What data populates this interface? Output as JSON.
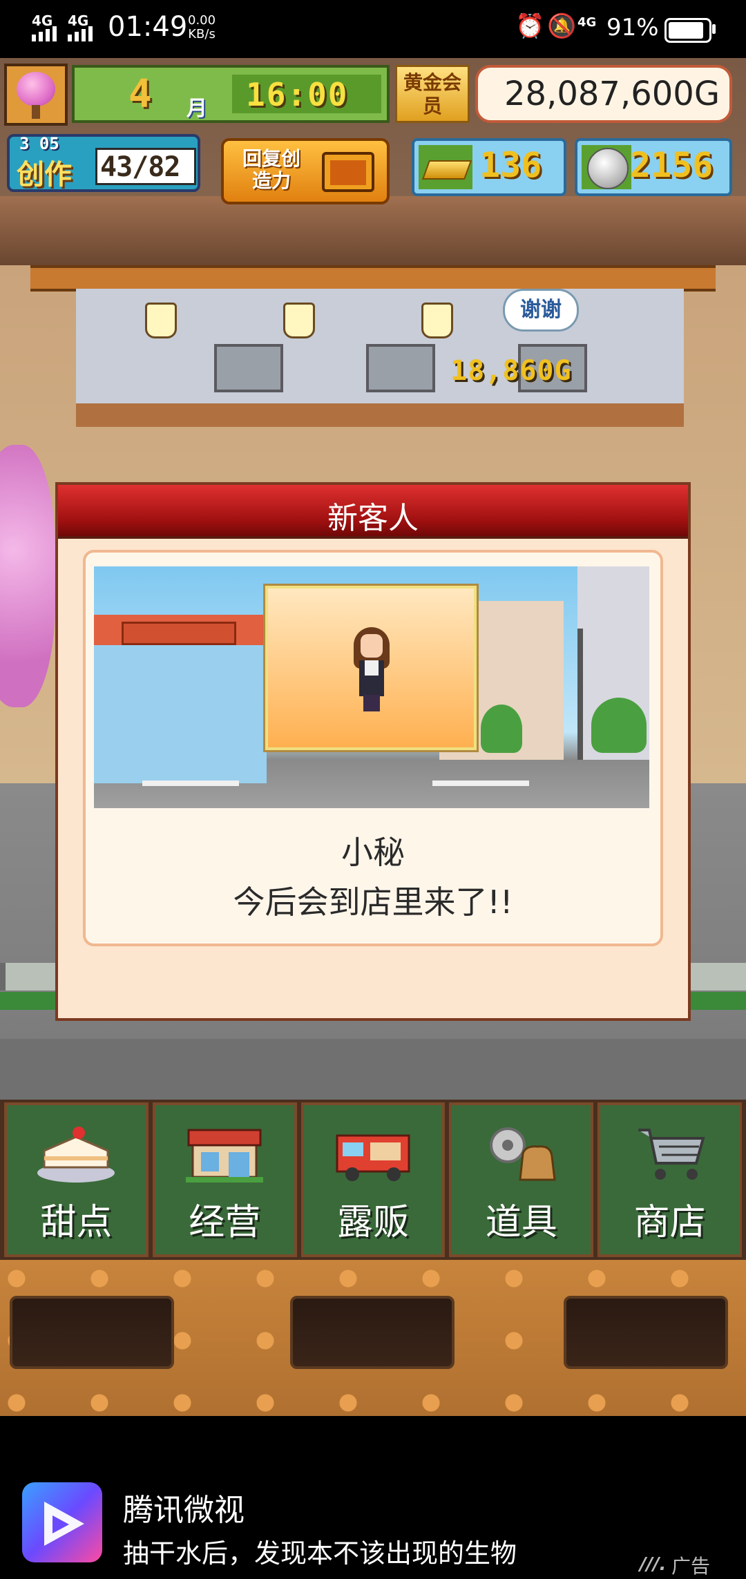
{
  "status_bar": {
    "signal1": "4G",
    "signal2": "4G",
    "time": "01:49",
    "speed_value": "0.00",
    "speed_unit": "KB/s",
    "network": "4G",
    "battery_percent": "91%",
    "battery_level": 0.91,
    "icons": [
      "alarm-icon",
      "bell-off-icon"
    ]
  },
  "hud": {
    "month_number": "4",
    "month_unit": "月",
    "clock": "16:00",
    "gold_member_label": "黄金会员",
    "money": "28,087,600G",
    "create_level": "3 05",
    "create_label": "创作",
    "create_count": "43/82",
    "restore_label": "回复创造力",
    "gold_bars": "136",
    "coins": "2156"
  },
  "scene": {
    "speech_bubble": "谢谢",
    "earning": "18,860G"
  },
  "dialog": {
    "title": "新客人",
    "customer_name": "小秘",
    "message": "今后会到店里来了!!"
  },
  "menu": {
    "items": [
      {
        "label": "甜点",
        "icon": "cake-icon"
      },
      {
        "label": "经营",
        "icon": "shop-icon"
      },
      {
        "label": "露贩",
        "icon": "food-truck-icon"
      },
      {
        "label": "道具",
        "icon": "gear-bag-icon"
      },
      {
        "label": "商店",
        "icon": "shopping-cart-icon"
      }
    ]
  },
  "ad": {
    "app_name": "腾讯微视",
    "text": "抽干水后，发现本不该出现的生物",
    "tag": "广告"
  },
  "colors": {
    "modal_header": "#c01818",
    "menu_button": "#3a6a3a",
    "money_border": "#c25a3a"
  }
}
